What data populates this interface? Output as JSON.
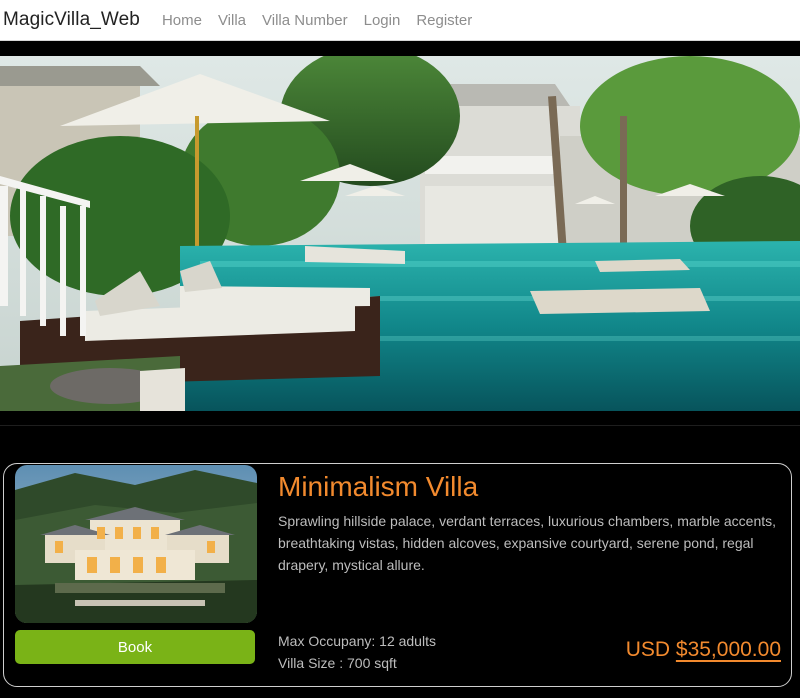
{
  "navbar": {
    "brand": "MagicVilla_Web",
    "links": [
      "Home",
      "Villa",
      "Villa Number",
      "Login",
      "Register"
    ]
  },
  "villa": {
    "name": "Minimalism Villa",
    "description": "Sprawling hillside palace, verdant terraces, luxurious chambers, marble accents, breathtaking vistas, hidden alcoves, expansive courtyard, serene pond, regal drapery, mystical allure.",
    "occupancy": "Max Occupany: 12 adults",
    "size": "Villa Size : 700 sqft",
    "currency": "USD",
    "price": "$35,000.00",
    "book_label": "Book"
  },
  "colors": {
    "accent": "#f28a2e",
    "book": "#7ab317",
    "background": "#000000"
  }
}
